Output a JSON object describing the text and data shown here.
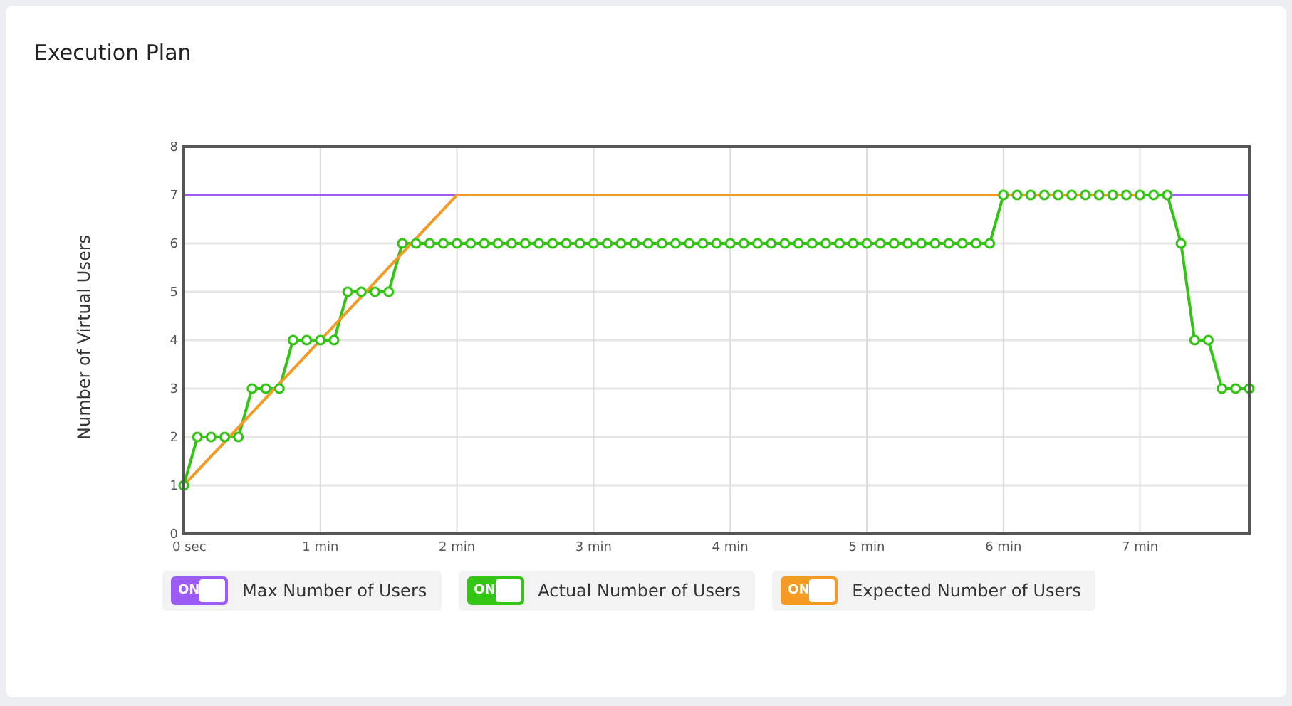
{
  "title": "Execution Plan",
  "chart": {
    "chart_data": {
      "type": "line",
      "ylabel": "Number of Virtual Users",
      "grid": true,
      "x": [
        0,
        0.1,
        0.2,
        0.3,
        0.4,
        0.5,
        0.6,
        0.7,
        0.8,
        0.9,
        1,
        1.1,
        1.2,
        1.3,
        1.4,
        1.5,
        1.6,
        1.7,
        1.8,
        1.9,
        2,
        2.1,
        2.2,
        2.3,
        2.4,
        2.5,
        2.6,
        2.7,
        2.8,
        2.9,
        3,
        3.1,
        3.2,
        3.3,
        3.4,
        3.5,
        3.6,
        3.7,
        3.8,
        3.9,
        4,
        4.1,
        4.2,
        4.3,
        4.4,
        4.5,
        4.6,
        4.7,
        4.8,
        4.9,
        5,
        5.1,
        5.2,
        5.3,
        5.4,
        5.5,
        5.6,
        5.7,
        5.8,
        5.9,
        6,
        6.1,
        6.2,
        6.3,
        6.4,
        6.5,
        6.6,
        6.7,
        6.8,
        6.9,
        7,
        7.1,
        7.2,
        7.3,
        7.4,
        7.5,
        7.6,
        7.7,
        7.8
      ],
      "series": [
        {
          "name": "Max Number of Users",
          "color": "#9b5cf6",
          "values": [
            7,
            7,
            7,
            7,
            7,
            7,
            7,
            7,
            7,
            7,
            7,
            7,
            7,
            7,
            7,
            7,
            7,
            7,
            7,
            7,
            7,
            null,
            null,
            null,
            null,
            null,
            null,
            null,
            null,
            null,
            null,
            null,
            null,
            null,
            null,
            null,
            null,
            null,
            null,
            null,
            null,
            null,
            null,
            null,
            null,
            null,
            null,
            null,
            null,
            null,
            null,
            null,
            null,
            null,
            null,
            null,
            null,
            null,
            null,
            null,
            null,
            null,
            null,
            null,
            null,
            null,
            null,
            null,
            null,
            null,
            null,
            null,
            7,
            7,
            7,
            7,
            7,
            7,
            7
          ]
        },
        {
          "name": "Actual Number of Users",
          "color": "#33c514",
          "marker": "circle",
          "values": [
            1,
            2,
            2,
            2,
            2,
            3,
            3,
            3,
            4,
            4,
            4,
            4,
            5,
            5,
            5,
            5,
            6,
            6,
            6,
            6,
            6,
            6,
            6,
            6,
            6,
            6,
            6,
            6,
            6,
            6,
            6,
            6,
            6,
            6,
            6,
            6,
            6,
            6,
            6,
            6,
            6,
            6,
            6,
            6,
            6,
            6,
            6,
            6,
            6,
            6,
            6,
            6,
            6,
            6,
            6,
            6,
            6,
            6,
            6,
            6,
            7,
            7,
            7,
            7,
            7,
            7,
            7,
            7,
            7,
            7,
            7,
            7,
            7,
            6,
            4,
            4,
            3,
            3,
            3
          ]
        },
        {
          "name": "Expected Number of Users",
          "color": "#f59a23",
          "values": [
            1,
            1.3,
            1.6,
            1.9,
            2.2,
            2.5,
            2.8,
            3.1,
            3.4,
            3.7,
            4,
            4.3,
            4.6,
            4.9,
            5.2,
            5.5,
            5.8,
            6.1,
            6.4,
            6.7,
            7,
            7,
            7,
            7,
            7,
            7,
            7,
            7,
            7,
            7,
            7,
            7,
            7,
            7,
            7,
            7,
            7,
            7,
            7,
            7,
            7,
            7,
            7,
            7,
            7,
            7,
            7,
            7,
            7,
            7,
            7,
            7,
            7,
            7,
            7,
            7,
            7,
            7,
            7,
            7,
            7,
            7,
            7,
            7,
            7,
            7,
            7,
            7,
            7,
            7,
            7,
            null,
            null,
            null,
            null,
            null,
            null,
            null,
            null
          ]
        }
      ],
      "xlim": [
        0,
        7.8
      ],
      "ylim": [
        0,
        8
      ],
      "xticks": [
        {
          "value": 0,
          "label": "0 sec"
        },
        {
          "value": 1,
          "label": "1 min"
        },
        {
          "value": 2,
          "label": "2 min"
        },
        {
          "value": 3,
          "label": "3 min"
        },
        {
          "value": 4,
          "label": "4 min"
        },
        {
          "value": 5,
          "label": "5 min"
        },
        {
          "value": 6,
          "label": "6 min"
        },
        {
          "value": 7,
          "label": "7 min"
        }
      ],
      "yticks": [
        0,
        1,
        2,
        3,
        4,
        5,
        6,
        7,
        8
      ]
    }
  },
  "legend": [
    {
      "toggle_text": "ON",
      "on": true
    },
    {
      "toggle_text": "ON",
      "on": true
    },
    {
      "toggle_text": "ON",
      "on": true
    }
  ]
}
